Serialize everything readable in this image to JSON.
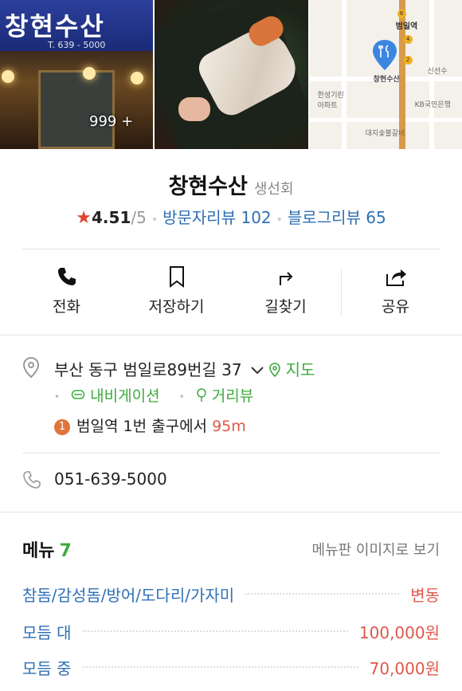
{
  "photos": {
    "sign_text": "창현수산",
    "sign_tel": "T. 639 - 5000",
    "count_label": "999 +",
    "map_labels": {
      "station": "범일역",
      "restaurant": "창현수산",
      "apartment": "한성기린\n아파트",
      "bank": "KB국민은행",
      "shop": "대지숯불갈비",
      "sinseon": "신선수"
    }
  },
  "place": {
    "name": "창현수산",
    "category": "생선회",
    "rating": "4.51",
    "rating_max": "/5",
    "visitor_reviews": "방문자리뷰 102",
    "blog_reviews": "블로그리뷰 65"
  },
  "actions": [
    {
      "label": "전화",
      "icon": "phone-icon"
    },
    {
      "label": "저장하기",
      "icon": "bookmark-icon"
    },
    {
      "label": "길찾기",
      "icon": "directions-icon"
    },
    {
      "label": "공유",
      "icon": "share-icon"
    }
  ],
  "address": {
    "text": "부산 동구 범일로89번길 37",
    "map_link": "지도",
    "navigation": "내비게이션",
    "street_view": "거리뷰",
    "subway_line": "1",
    "subway_station": "범일역",
    "subway_exit": "1번 출구에서",
    "subway_distance": "95m",
    "phone": "051-639-5000"
  },
  "menu": {
    "title": "메뉴",
    "count": "7",
    "view_image": "메뉴판 이미지로 보기",
    "items": [
      {
        "name": "참돔/감성돔/방어/도다리/가자미",
        "price": "변동"
      },
      {
        "name": "모듬 대",
        "price": "100,000원"
      },
      {
        "name": "모듬 중",
        "price": "70,000원"
      }
    ]
  },
  "colors": {
    "accent_blue": "#2e6fb5",
    "accent_green": "#3daa3d",
    "price_red": "#e0574a",
    "star_red": "#e0432f"
  }
}
